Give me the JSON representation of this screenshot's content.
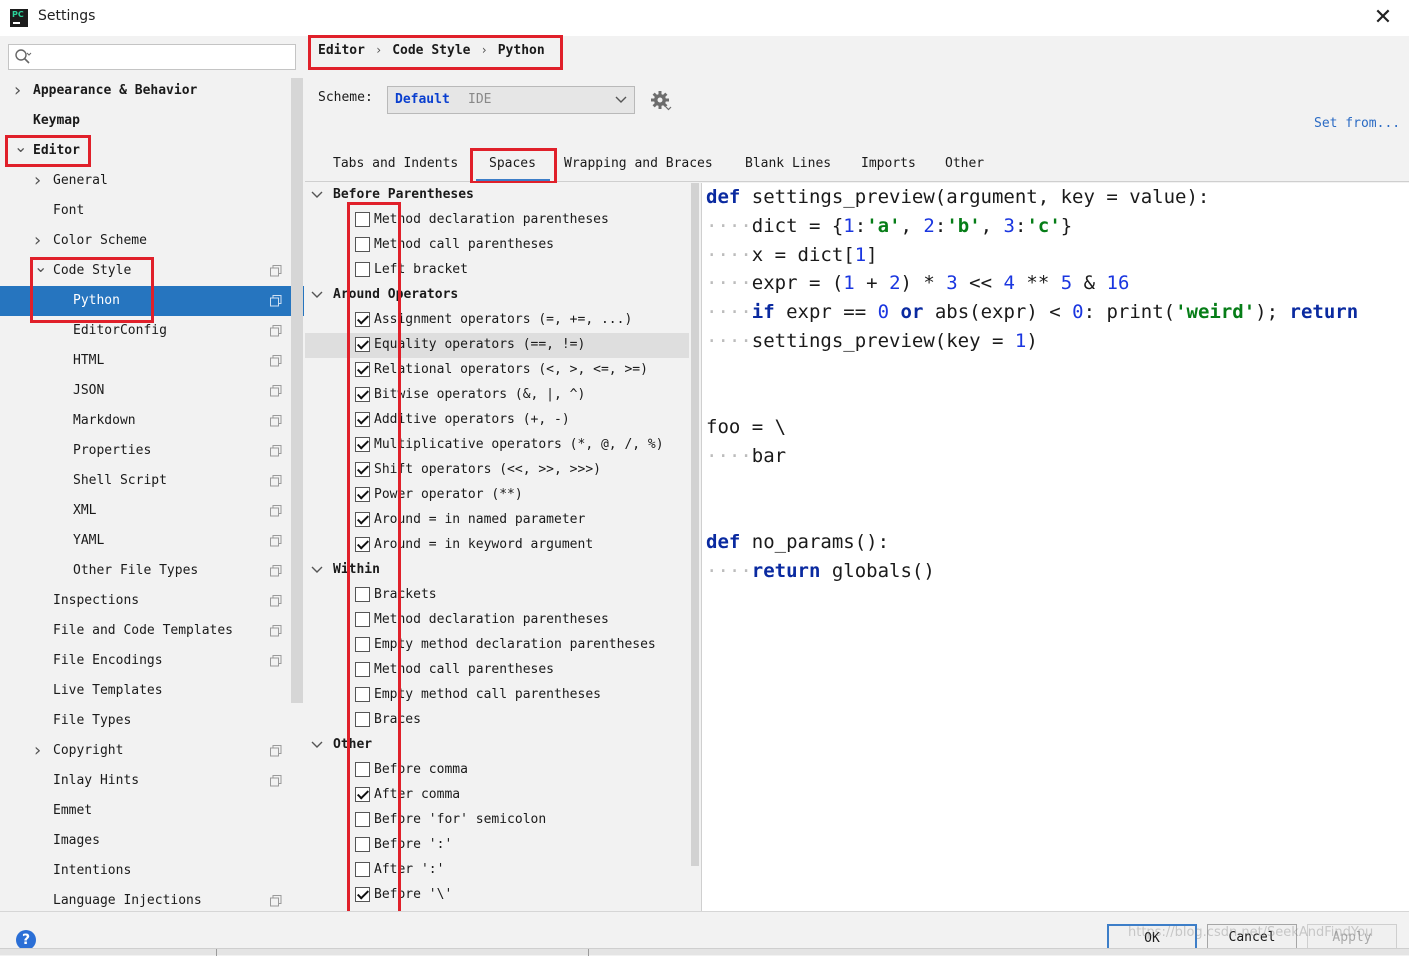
{
  "window": {
    "title": "Settings",
    "app_icon_text": "PC"
  },
  "search": {
    "placeholder": ""
  },
  "tree": [
    {
      "label": "Appearance & Behavior",
      "level": 0,
      "bold": true,
      "arrow": "right",
      "copy": false
    },
    {
      "label": "Keymap",
      "level": 0,
      "bold": true,
      "arrow": "",
      "copy": false
    },
    {
      "label": "Editor",
      "level": 0,
      "bold": true,
      "arrow": "down",
      "copy": false
    },
    {
      "label": "General",
      "level": 1,
      "bold": false,
      "arrow": "right",
      "copy": false
    },
    {
      "label": "Font",
      "level": 1,
      "bold": false,
      "arrow": "",
      "copy": false
    },
    {
      "label": "Color Scheme",
      "level": 1,
      "bold": false,
      "arrow": "right",
      "copy": false
    },
    {
      "label": "Code Style",
      "level": 1,
      "bold": false,
      "arrow": "down",
      "copy": true
    },
    {
      "label": "Python",
      "level": 2,
      "bold": false,
      "arrow": "",
      "copy": true,
      "selected": true
    },
    {
      "label": "EditorConfig",
      "level": 2,
      "bold": false,
      "arrow": "",
      "copy": true
    },
    {
      "label": "HTML",
      "level": 2,
      "bold": false,
      "arrow": "",
      "copy": true
    },
    {
      "label": "JSON",
      "level": 2,
      "bold": false,
      "arrow": "",
      "copy": true
    },
    {
      "label": "Markdown",
      "level": 2,
      "bold": false,
      "arrow": "",
      "copy": true
    },
    {
      "label": "Properties",
      "level": 2,
      "bold": false,
      "arrow": "",
      "copy": true
    },
    {
      "label": "Shell Script",
      "level": 2,
      "bold": false,
      "arrow": "",
      "copy": true
    },
    {
      "label": "XML",
      "level": 2,
      "bold": false,
      "arrow": "",
      "copy": true
    },
    {
      "label": "YAML",
      "level": 2,
      "bold": false,
      "arrow": "",
      "copy": true
    },
    {
      "label": "Other File Types",
      "level": 2,
      "bold": false,
      "arrow": "",
      "copy": true
    },
    {
      "label": "Inspections",
      "level": 1,
      "bold": false,
      "arrow": "",
      "copy": true
    },
    {
      "label": "File and Code Templates",
      "level": 1,
      "bold": false,
      "arrow": "",
      "copy": true
    },
    {
      "label": "File Encodings",
      "level": 1,
      "bold": false,
      "arrow": "",
      "copy": true
    },
    {
      "label": "Live Templates",
      "level": 1,
      "bold": false,
      "arrow": "",
      "copy": false
    },
    {
      "label": "File Types",
      "level": 1,
      "bold": false,
      "arrow": "",
      "copy": false
    },
    {
      "label": "Copyright",
      "level": 1,
      "bold": false,
      "arrow": "right",
      "copy": true
    },
    {
      "label": "Inlay Hints",
      "level": 1,
      "bold": false,
      "arrow": "",
      "copy": true
    },
    {
      "label": "Emmet",
      "level": 1,
      "bold": false,
      "arrow": "",
      "copy": false
    },
    {
      "label": "Images",
      "level": 1,
      "bold": false,
      "arrow": "",
      "copy": false
    },
    {
      "label": "Intentions",
      "level": 1,
      "bold": false,
      "arrow": "",
      "copy": false
    },
    {
      "label": "Language Injections",
      "level": 1,
      "bold": false,
      "arrow": "",
      "copy": true
    }
  ],
  "breadcrumb": [
    "Editor",
    "Code Style",
    "Python"
  ],
  "scheme": {
    "label": "Scheme:",
    "value": "Default",
    "kind": "IDE",
    "set_from": "Set from..."
  },
  "tabs": [
    {
      "label": "Tabs and Indents",
      "active": false
    },
    {
      "label": "Spaces",
      "active": true
    },
    {
      "label": "Wrapping and Braces",
      "active": false
    },
    {
      "label": "Blank Lines",
      "active": false
    },
    {
      "label": "Imports",
      "active": false
    },
    {
      "label": "Other",
      "active": false
    }
  ],
  "option_groups": [
    {
      "title": "Before Parentheses",
      "items": [
        {
          "label": "Method declaration parentheses",
          "checked": false
        },
        {
          "label": "Method call parentheses",
          "checked": false
        },
        {
          "label": "Left bracket",
          "checked": false
        }
      ]
    },
    {
      "title": "Around Operators",
      "items": [
        {
          "label": "Assignment operators (=, +=, ...)",
          "checked": true
        },
        {
          "label": "Equality operators (==, !=)",
          "checked": true,
          "highlight": true
        },
        {
          "label": "Relational operators (<, >, <=, >=)",
          "checked": true
        },
        {
          "label": "Bitwise operators (&, |, ^)",
          "checked": true
        },
        {
          "label": "Additive operators (+, -)",
          "checked": true
        },
        {
          "label": "Multiplicative operators (*, @, /, %)",
          "checked": true
        },
        {
          "label": "Shift operators (<<, >>, >>>)",
          "checked": true
        },
        {
          "label": "Power operator (**)",
          "checked": true
        },
        {
          "label": "Around = in named parameter",
          "checked": true
        },
        {
          "label": "Around = in keyword argument",
          "checked": true
        }
      ]
    },
    {
      "title": "Within",
      "items": [
        {
          "label": "Brackets",
          "checked": false
        },
        {
          "label": "Method declaration parentheses",
          "checked": false
        },
        {
          "label": "Empty method declaration parentheses",
          "checked": false
        },
        {
          "label": "Method call parentheses",
          "checked": false
        },
        {
          "label": "Empty method call parentheses",
          "checked": false
        },
        {
          "label": "Braces",
          "checked": false
        }
      ]
    },
    {
      "title": "Other",
      "items": [
        {
          "label": "Before comma",
          "checked": false
        },
        {
          "label": "After comma",
          "checked": true
        },
        {
          "label": "Before 'for' semicolon",
          "checked": false
        },
        {
          "label": "Before ':'",
          "checked": false
        },
        {
          "label": "After ':'",
          "checked": false
        },
        {
          "label": "Before '\\'",
          "checked": true
        }
      ]
    }
  ],
  "code_preview": [
    [
      [
        "kw",
        "def"
      ],
      [
        "t",
        " settings_preview(argument, key = value):"
      ]
    ],
    [
      [
        "ws",
        "····"
      ],
      [
        "t",
        "dict = {"
      ],
      [
        "num",
        "1"
      ],
      [
        "t",
        ":"
      ],
      [
        "str",
        "'a'"
      ],
      [
        "t",
        ", "
      ],
      [
        "num",
        "2"
      ],
      [
        "t",
        ":"
      ],
      [
        "str",
        "'b'"
      ],
      [
        "t",
        ", "
      ],
      [
        "num",
        "3"
      ],
      [
        "t",
        ":"
      ],
      [
        "str",
        "'c'"
      ],
      [
        "t",
        "}"
      ]
    ],
    [
      [
        "ws",
        "····"
      ],
      [
        "t",
        "x = dict["
      ],
      [
        "num",
        "1"
      ],
      [
        "t",
        "]"
      ]
    ],
    [
      [
        "ws",
        "····"
      ],
      [
        "t",
        "expr = ("
      ],
      [
        "num",
        "1"
      ],
      [
        "t",
        " + "
      ],
      [
        "num",
        "2"
      ],
      [
        "t",
        ") * "
      ],
      [
        "num",
        "3"
      ],
      [
        "t",
        " << "
      ],
      [
        "num",
        "4"
      ],
      [
        "t",
        " ** "
      ],
      [
        "num",
        "5"
      ],
      [
        "t",
        " & "
      ],
      [
        "num",
        "16"
      ]
    ],
    [
      [
        "ws",
        "····"
      ],
      [
        "kw",
        "if"
      ],
      [
        "t",
        " expr == "
      ],
      [
        "num",
        "0"
      ],
      [
        "t",
        " "
      ],
      [
        "kw",
        "or"
      ],
      [
        "t",
        " abs(expr) < "
      ],
      [
        "num",
        "0"
      ],
      [
        "t",
        ": print("
      ],
      [
        "str",
        "'weird'"
      ],
      [
        "t",
        "); "
      ],
      [
        "kw",
        "return"
      ]
    ],
    [
      [
        "ws",
        "····"
      ],
      [
        "t",
        "settings_preview(key = "
      ],
      [
        "num",
        "1"
      ],
      [
        "t",
        ")"
      ]
    ],
    [],
    [],
    [
      [
        "t",
        "foo = \\"
      ]
    ],
    [
      [
        "ws",
        "····"
      ],
      [
        "t",
        "bar"
      ]
    ],
    [],
    [],
    [
      [
        "kw",
        "def"
      ],
      [
        "t",
        " no_params():"
      ]
    ],
    [
      [
        "ws",
        "····"
      ],
      [
        "kw",
        "return"
      ],
      [
        "t",
        " globals()"
      ]
    ]
  ],
  "buttons": {
    "ok": "OK",
    "cancel": "Cancel",
    "apply": "Apply"
  },
  "help_label": "?",
  "watermark": "https://blog.csdn.net/SeekAndFindYou",
  "colors": {
    "selection": "#2675bf",
    "annotation_box": "#e0202a",
    "link": "#2b6bc4"
  }
}
